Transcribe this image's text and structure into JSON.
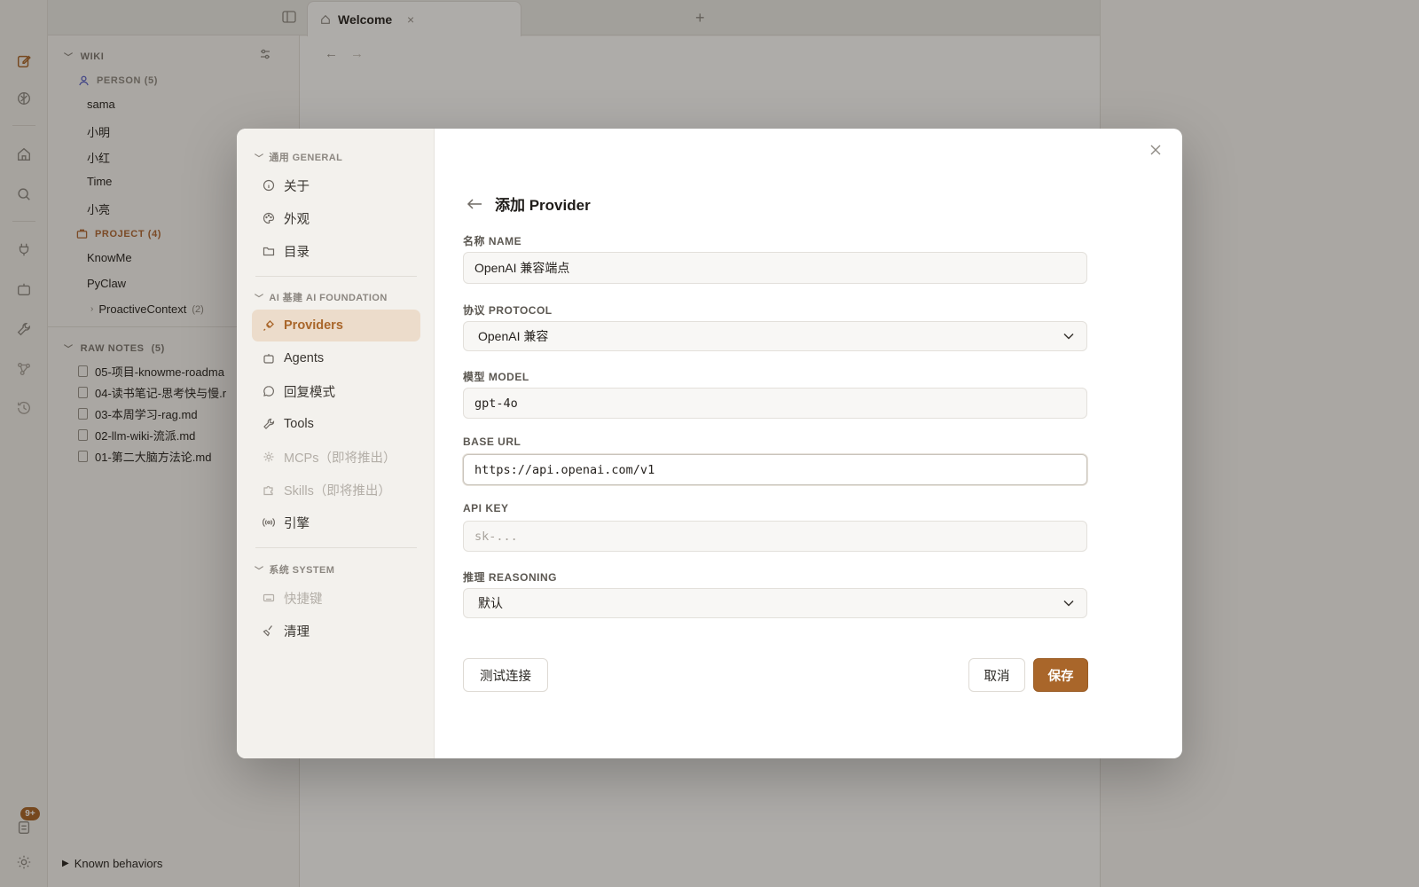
{
  "tabs": {
    "welcome_title": "Welcome"
  },
  "sidebar": {
    "wiki_label": "WIKI",
    "person_label": "PERSON (5)",
    "persons": [
      "sama",
      "小明",
      "小红",
      "Time",
      "小亮"
    ],
    "project_label": "PROJECT (4)",
    "projects": [
      "KnowMe",
      "PyClaw"
    ],
    "proactive": {
      "label": "ProactiveContext",
      "count": "(2)"
    },
    "raw_notes_label": "RAW NOTES",
    "raw_notes_count": "(5)",
    "raw_notes": [
      "05-项目-knowme-roadma",
      "04-读书笔记-思考快与慢.r",
      "03-本周学习-rag.md",
      "02-llm-wiki-流派.md",
      "01-第二大脑方法论.md"
    ],
    "known_behaviors": "Known behaviors",
    "badge": "9+"
  },
  "settings": {
    "sections": {
      "general": "通用 GENERAL",
      "ai": "AI 基建 AI FOUNDATION",
      "system": "系统 SYSTEM"
    },
    "general_items": [
      "关于",
      "外观",
      "目录"
    ],
    "ai_items": [
      "Providers",
      "Agents",
      "回复模式",
      "Tools",
      "MCPs（即将推出）",
      "Skills（即将推出）",
      "引擎"
    ],
    "system_items": [
      "快捷键",
      "清理"
    ]
  },
  "form": {
    "title": "添加 Provider",
    "name_label": "名称 NAME",
    "name_value": "OpenAI 兼容端点",
    "protocol_label": "协议 PROTOCOL",
    "protocol_value": "OpenAI 兼容",
    "model_label": "模型 MODEL",
    "model_value": "gpt-4o",
    "base_url_label": "BASE URL",
    "base_url_value": "https://api.openai.com/v1",
    "api_key_label": "API KEY",
    "api_key_placeholder": "sk-...",
    "reasoning_label": "推理 REASONING",
    "reasoning_value": "默认",
    "test_button": "测试连接",
    "cancel_button": "取消",
    "save_button": "保存"
  },
  "colors": {
    "accent": "#a9662a",
    "active_bg": "#ecdccb",
    "person_icon": "#5b63c9",
    "project_icon": "#b06a36"
  },
  "icons": {
    "rail": [
      "edit-icon",
      "brain-icon",
      "home-icon",
      "search-icon",
      "plug-icon",
      "bot-icon",
      "wrench-icon",
      "graph-icon",
      "history-icon",
      "inbox-icon",
      "settings-icon"
    ]
  }
}
